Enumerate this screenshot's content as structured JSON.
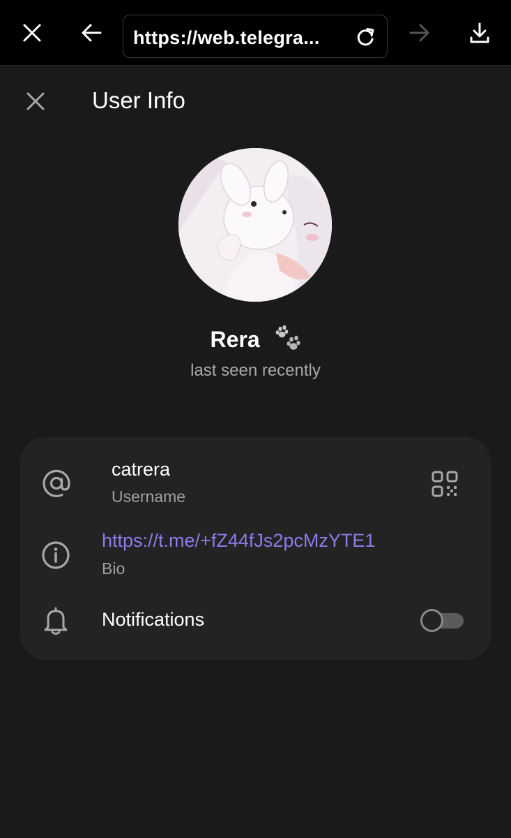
{
  "browser": {
    "url": "https://web.telegra...",
    "icons": {
      "close": "close-icon",
      "back": "arrow-left-icon",
      "reload": "reload-icon",
      "forward": "arrow-right-icon",
      "download": "download-icon"
    }
  },
  "header": {
    "title": "User Info"
  },
  "profile": {
    "name": "Rera",
    "status": "last seen recently"
  },
  "info": {
    "username_value": "catrera",
    "username_label": "Username",
    "bio_value": "https://t.me/+fZ44fJs2pcMzYTE1",
    "bio_label": "Bio",
    "notifications_label": "Notifications",
    "notifications_enabled": false
  },
  "colors": {
    "background": "#1a1a1a",
    "card": "#232323",
    "link": "#8f7ae8",
    "secondary_text": "#a0a0a0"
  }
}
